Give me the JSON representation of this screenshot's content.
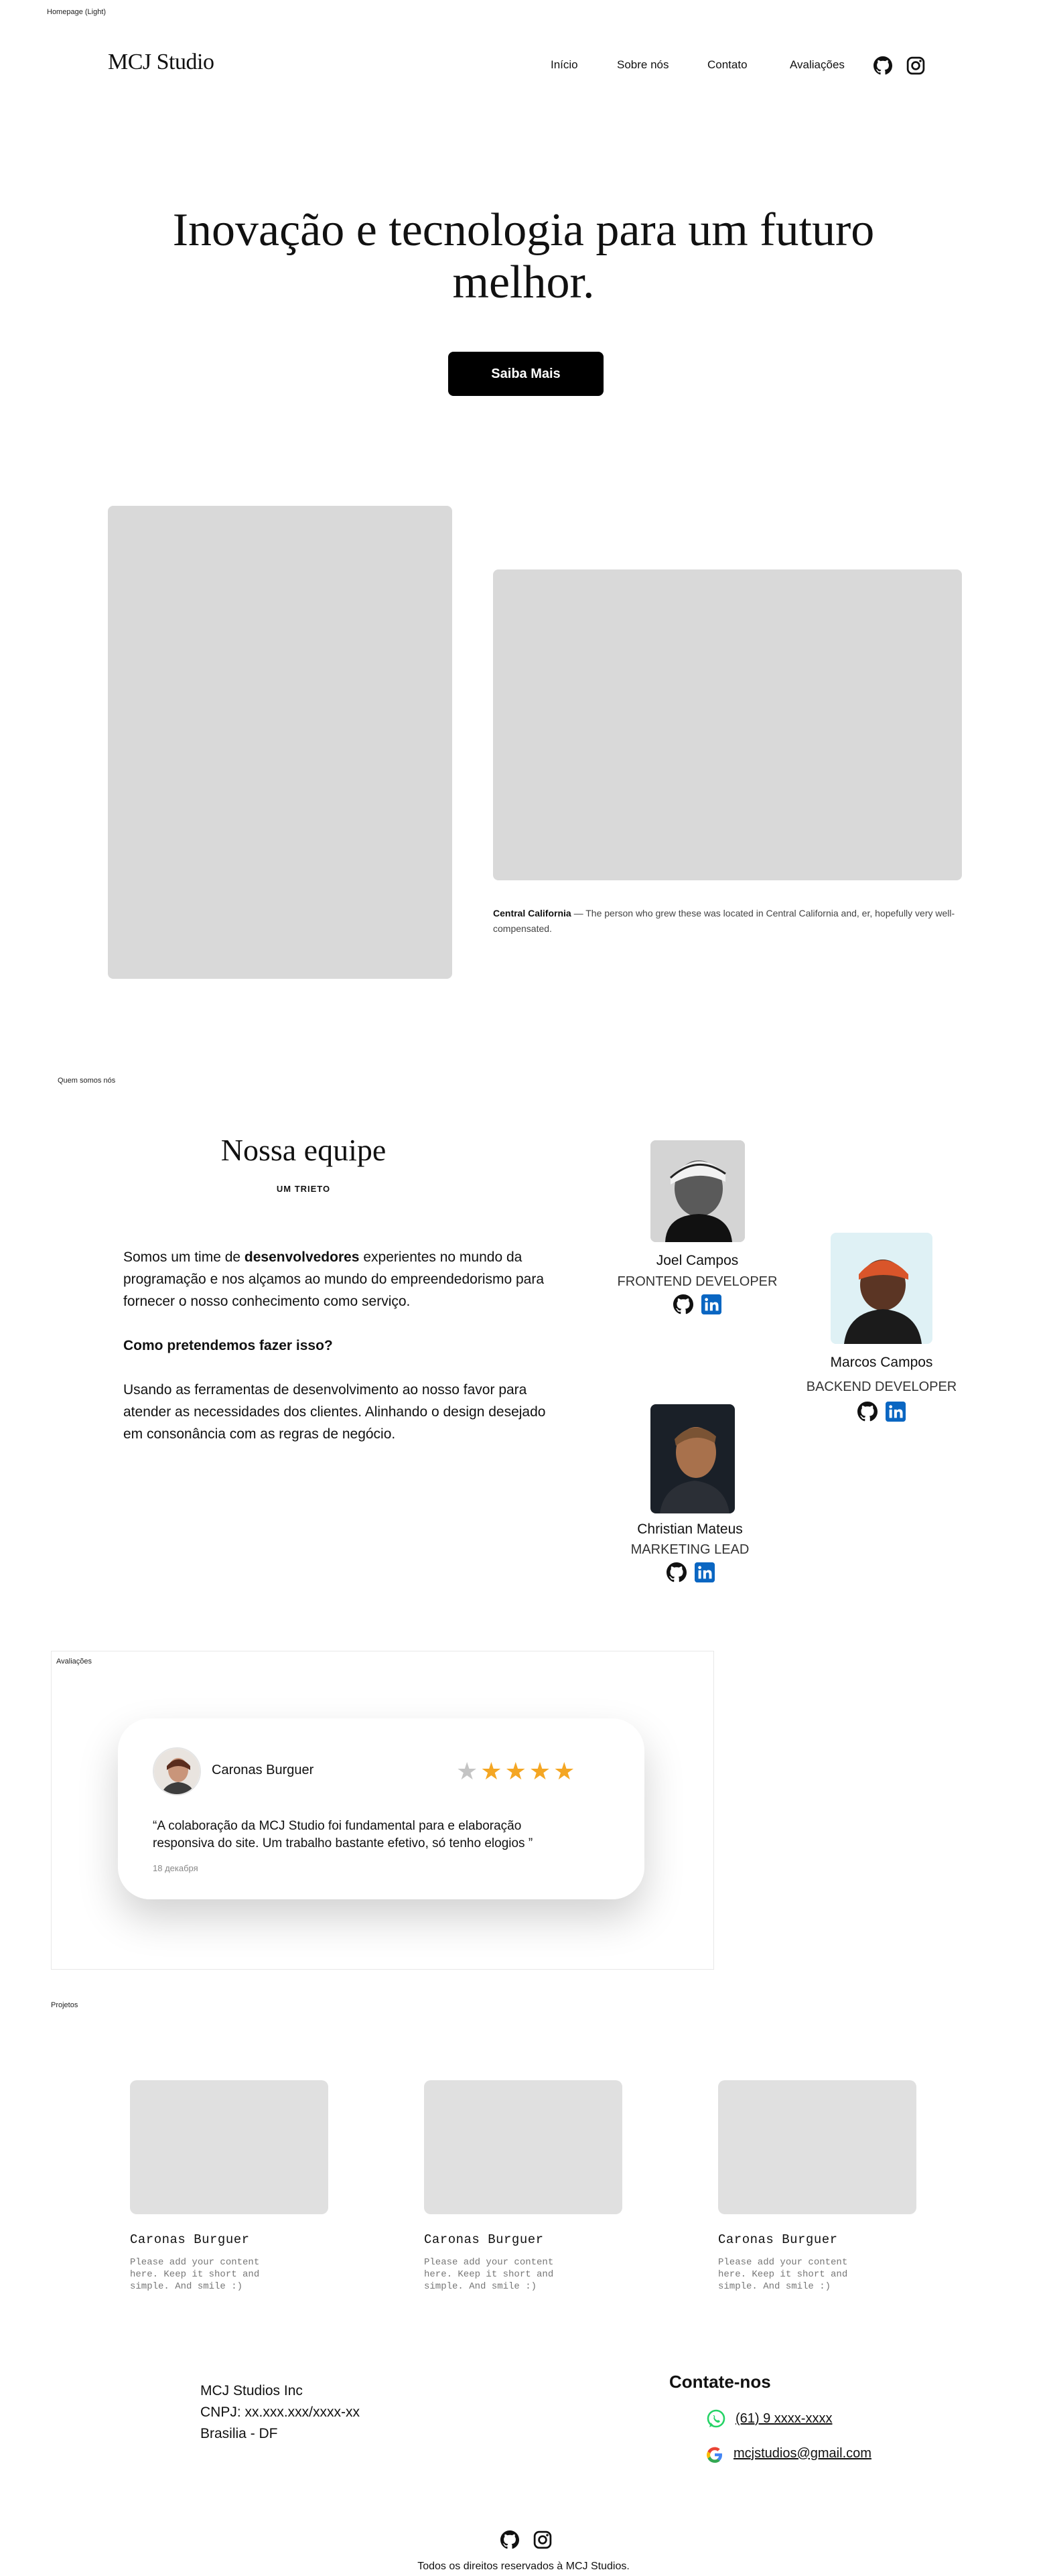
{
  "frame_labels": {
    "homepage": "Homepage (Light)",
    "about": "Quem somos nós",
    "reviews": "Avaliações",
    "projects": "Projetos"
  },
  "header": {
    "logo": "MCJ Studio",
    "nav": [
      "Início",
      "Sobre nós",
      "Contato",
      "Avaliações"
    ],
    "icons": [
      "github-icon",
      "instagram-icon"
    ]
  },
  "hero": {
    "title": "Inovação e tecnologia para um futuro melhor.",
    "cta": "Saiba Mais"
  },
  "gallery": {
    "caption_bold": "Central California",
    "caption_text": " — The person who grew these was located in Central California and, er, hopefully very well-compensated."
  },
  "team": {
    "title": "Nossa equipe",
    "subtitle": "UM TRIETO",
    "intro_before": "Somos um time de ",
    "intro_bold": "desenvolvedores",
    "intro_after": " experientes no mundo da programação e nos alçamos ao mundo do empreendedorismo para fornecer o nosso conhecimento como serviço.",
    "question": "Como pretendemos fazer isso?",
    "answer": "Usando as ferramentas de desenvolvimento ao nosso favor para atender as necessidades dos clientes. Alinhando o design desejado em consonância com as regras de negócio.",
    "members": [
      {
        "name": "Joel Campos",
        "role": "FRONTEND DEVELOPER"
      },
      {
        "name": "Marcos Campos",
        "role": "BACKEND DEVELOPER"
      },
      {
        "name": "Christian Mateus",
        "role": "MARKETING LEAD"
      }
    ]
  },
  "review": {
    "author": "Caronas Burguer",
    "rating": 4,
    "max_rating": 5,
    "text": "“A colaboração da MCJ Studio foi fundamental para e elaboração responsiva do site. Um trabalho bastante efetivo, só tenho elogios ”",
    "date": "18 декабря",
    "colors": {
      "star_on": "#f4a623",
      "star_off": "#c4c4c4"
    }
  },
  "projects": [
    {
      "title": "Caronas Burguer",
      "desc": "Please add your content here. Keep it short and simple. And smile :)"
    },
    {
      "title": "Caronas Burguer",
      "desc": "Please add your content here. Keep it short and simple. And smile :)"
    },
    {
      "title": "Caronas Burguer",
      "desc": "Please add your content here. Keep it short and simple. And smile :)"
    }
  ],
  "footer": {
    "company": "MCJ Studios Inc",
    "cnpj": "CNPJ: xx.xxx.xxx/xxxx-xx",
    "location": "Brasilia - DF",
    "contact_title": "Contate-nos",
    "phone": "(61) 9 xxxx-xxxx",
    "email": "mcjstudios@gmail.com",
    "copyright": "Todos os direitos reservados à MCJ Studios."
  }
}
